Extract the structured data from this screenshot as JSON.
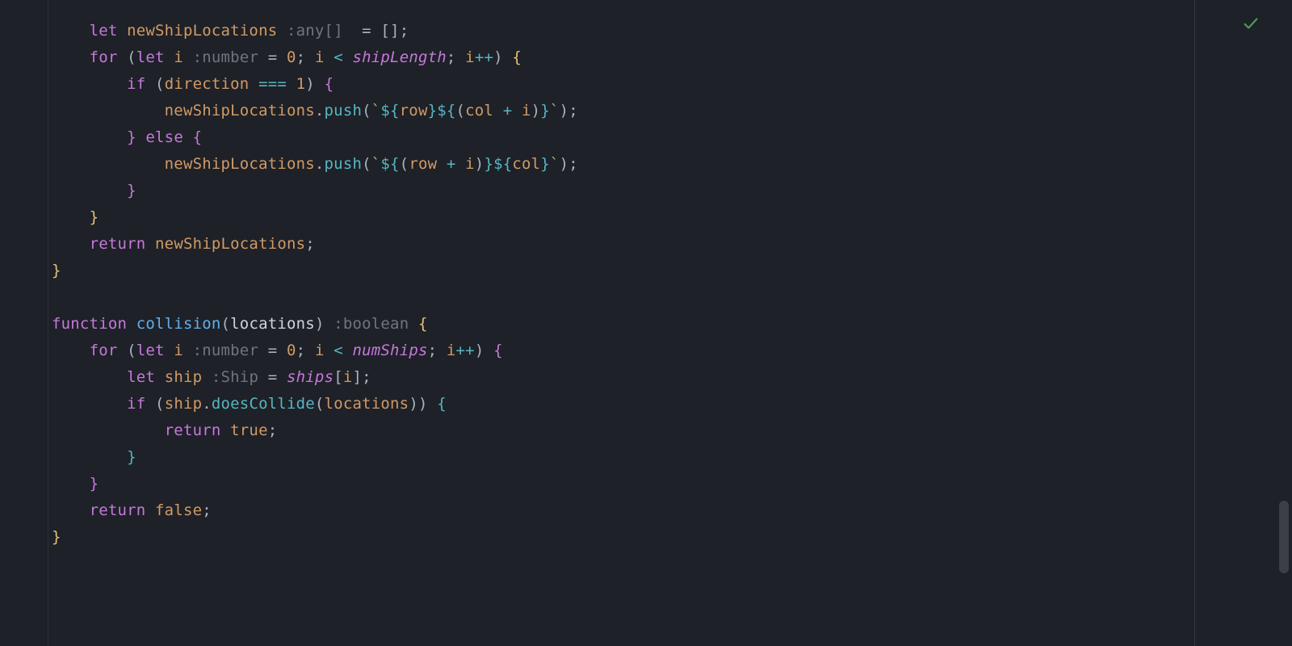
{
  "status": {
    "ok": true,
    "icon": "check-icon"
  },
  "colors": {
    "bg": "#1e2127",
    "keyword": "#c678dd",
    "function": "#61afef",
    "method": "#56b6c2",
    "ident": "#d19a66",
    "hint": "#6e7581",
    "string": "#98c379",
    "brace_yellow": "#e5c07b",
    "brace_purple": "#c678dd",
    "brace_blue": "#56b6c2",
    "default": "#abb2bf"
  },
  "code": {
    "lines": [
      {
        "indent": 1,
        "tokens": [
          [
            "kw",
            "let"
          ],
          [
            "sp",
            " "
          ],
          [
            "ident",
            "newShipLocations"
          ],
          [
            "sp",
            " "
          ],
          [
            "hint",
            ":any[]"
          ],
          [
            "sp",
            "  "
          ],
          [
            "eq",
            "="
          ],
          [
            "sp",
            " "
          ],
          [
            "punc",
            "["
          ],
          [
            "punc",
            "]"
          ],
          [
            "punc",
            ";"
          ]
        ]
      },
      {
        "indent": 1,
        "tokens": [
          [
            "kw",
            "for"
          ],
          [
            "sp",
            " "
          ],
          [
            "par",
            "("
          ],
          [
            "kw",
            "let"
          ],
          [
            "sp",
            " "
          ],
          [
            "ident",
            "i"
          ],
          [
            "sp",
            " "
          ],
          [
            "hint",
            ":number"
          ],
          [
            "sp",
            " "
          ],
          [
            "eq",
            "="
          ],
          [
            "sp",
            " "
          ],
          [
            "num",
            "0"
          ],
          [
            "punc",
            ";"
          ],
          [
            "sp",
            " "
          ],
          [
            "ident",
            "i"
          ],
          [
            "sp",
            " "
          ],
          [
            "op",
            "<"
          ],
          [
            "sp",
            " "
          ],
          [
            "ital",
            "shipLength"
          ],
          [
            "punc",
            ";"
          ],
          [
            "sp",
            " "
          ],
          [
            "ident",
            "i"
          ],
          [
            "op",
            "++"
          ],
          [
            "par",
            ")"
          ],
          [
            "sp",
            " "
          ],
          [
            "brace-y",
            "{"
          ]
        ]
      },
      {
        "indent": 2,
        "guide": true,
        "tokens": [
          [
            "kw",
            "if"
          ],
          [
            "sp",
            " "
          ],
          [
            "par",
            "("
          ],
          [
            "ident",
            "direction"
          ],
          [
            "sp",
            " "
          ],
          [
            "op",
            "==="
          ],
          [
            "sp",
            " "
          ],
          [
            "num",
            "1"
          ],
          [
            "par",
            ")"
          ],
          [
            "sp",
            " "
          ],
          [
            "brace-p",
            "{"
          ]
        ]
      },
      {
        "indent": 3,
        "guide": true,
        "tokens": [
          [
            "ident",
            "newShipLocations"
          ],
          [
            "punc",
            "."
          ],
          [
            "method",
            "push"
          ],
          [
            "par",
            "("
          ],
          [
            "str",
            "`"
          ],
          [
            "brace-b",
            "${"
          ],
          [
            "ident",
            "row"
          ],
          [
            "brace-b",
            "}"
          ],
          [
            "brace-b",
            "${"
          ],
          [
            "par",
            "("
          ],
          [
            "ident",
            "col"
          ],
          [
            "sp",
            " "
          ],
          [
            "op",
            "+"
          ],
          [
            "sp",
            " "
          ],
          [
            "ident",
            "i"
          ],
          [
            "par",
            ")"
          ],
          [
            "brace-b",
            "}"
          ],
          [
            "str",
            "`"
          ],
          [
            "par",
            ")"
          ],
          [
            "punc",
            ";"
          ]
        ]
      },
      {
        "indent": 2,
        "guide": true,
        "tokens": [
          [
            "brace-p",
            "}"
          ],
          [
            "sp",
            " "
          ],
          [
            "kw",
            "else"
          ],
          [
            "sp",
            " "
          ],
          [
            "brace-p",
            "{"
          ]
        ]
      },
      {
        "indent": 3,
        "guide": true,
        "tokens": [
          [
            "ident",
            "newShipLocations"
          ],
          [
            "punc",
            "."
          ],
          [
            "method",
            "push"
          ],
          [
            "par",
            "("
          ],
          [
            "str",
            "`"
          ],
          [
            "brace-b",
            "${"
          ],
          [
            "par",
            "("
          ],
          [
            "ident",
            "row"
          ],
          [
            "sp",
            " "
          ],
          [
            "op",
            "+"
          ],
          [
            "sp",
            " "
          ],
          [
            "ident",
            "i"
          ],
          [
            "par",
            ")"
          ],
          [
            "brace-b",
            "}"
          ],
          [
            "brace-b",
            "${"
          ],
          [
            "ident",
            "col"
          ],
          [
            "brace-b",
            "}"
          ],
          [
            "str",
            "`"
          ],
          [
            "par",
            ")"
          ],
          [
            "punc",
            ";"
          ]
        ]
      },
      {
        "indent": 2,
        "guide": true,
        "tokens": [
          [
            "brace-p",
            "}"
          ]
        ]
      },
      {
        "indent": 1,
        "tokens": [
          [
            "brace-y",
            "}"
          ]
        ]
      },
      {
        "indent": 1,
        "tokens": [
          [
            "kw",
            "return"
          ],
          [
            "sp",
            " "
          ],
          [
            "ident",
            "newShipLocations"
          ],
          [
            "punc",
            ";"
          ]
        ]
      },
      {
        "indent": 0,
        "tokens": [
          [
            "brace-y",
            "}"
          ]
        ]
      },
      {
        "indent": 0,
        "tokens": []
      },
      {
        "indent": 0,
        "tokens": [
          [
            "kw",
            "function"
          ],
          [
            "sp",
            " "
          ],
          [
            "fnname",
            "collision"
          ],
          [
            "par",
            "("
          ],
          [
            "white",
            "locations"
          ],
          [
            "par",
            ")"
          ],
          [
            "sp",
            " "
          ],
          [
            "hint",
            ":boolean"
          ],
          [
            "sp",
            " "
          ],
          [
            "brace-y",
            "{"
          ]
        ]
      },
      {
        "indent": 1,
        "tokens": [
          [
            "kw",
            "for"
          ],
          [
            "sp",
            " "
          ],
          [
            "par",
            "("
          ],
          [
            "kw",
            "let"
          ],
          [
            "sp",
            " "
          ],
          [
            "ident",
            "i"
          ],
          [
            "sp",
            " "
          ],
          [
            "hint",
            ":number"
          ],
          [
            "sp",
            " "
          ],
          [
            "eq",
            "="
          ],
          [
            "sp",
            " "
          ],
          [
            "num",
            "0"
          ],
          [
            "punc",
            ";"
          ],
          [
            "sp",
            " "
          ],
          [
            "ident",
            "i"
          ],
          [
            "sp",
            " "
          ],
          [
            "op",
            "<"
          ],
          [
            "sp",
            " "
          ],
          [
            "ital",
            "numShips"
          ],
          [
            "punc",
            ";"
          ],
          [
            "sp",
            " "
          ],
          [
            "ident",
            "i"
          ],
          [
            "op",
            "++"
          ],
          [
            "par",
            ")"
          ],
          [
            "sp",
            " "
          ],
          [
            "brace-p",
            "{"
          ]
        ]
      },
      {
        "indent": 2,
        "guide": true,
        "tokens": [
          [
            "kw",
            "let"
          ],
          [
            "sp",
            " "
          ],
          [
            "ident",
            "ship"
          ],
          [
            "sp",
            " "
          ],
          [
            "hint",
            ":Ship"
          ],
          [
            "sp",
            " "
          ],
          [
            "eq",
            "="
          ],
          [
            "sp",
            " "
          ],
          [
            "ital",
            "ships"
          ],
          [
            "punc",
            "["
          ],
          [
            "ident",
            "i"
          ],
          [
            "punc",
            "]"
          ],
          [
            "punc",
            ";"
          ]
        ]
      },
      {
        "indent": 2,
        "guide": true,
        "tokens": [
          [
            "kw",
            "if"
          ],
          [
            "sp",
            " "
          ],
          [
            "par",
            "("
          ],
          [
            "ident",
            "ship"
          ],
          [
            "punc",
            "."
          ],
          [
            "method",
            "doesCollide"
          ],
          [
            "par",
            "("
          ],
          [
            "ident",
            "locations"
          ],
          [
            "par",
            ")"
          ],
          [
            "par",
            ")"
          ],
          [
            "sp",
            " "
          ],
          [
            "brace-b",
            "{"
          ]
        ]
      },
      {
        "indent": 3,
        "guide": true,
        "tokens": [
          [
            "kw",
            "return"
          ],
          [
            "sp",
            " "
          ],
          [
            "bool",
            "true"
          ],
          [
            "punc",
            ";"
          ]
        ]
      },
      {
        "indent": 2,
        "guide": true,
        "tokens": [
          [
            "brace-b",
            "}"
          ]
        ]
      },
      {
        "indent": 1,
        "tokens": [
          [
            "brace-p",
            "}"
          ]
        ]
      },
      {
        "indent": 1,
        "tokens": [
          [
            "kw",
            "return"
          ],
          [
            "sp",
            " "
          ],
          [
            "bool",
            "false"
          ],
          [
            "punc",
            ";"
          ]
        ]
      },
      {
        "indent": 0,
        "tokens": [
          [
            "brace-y",
            "}"
          ]
        ]
      }
    ]
  }
}
